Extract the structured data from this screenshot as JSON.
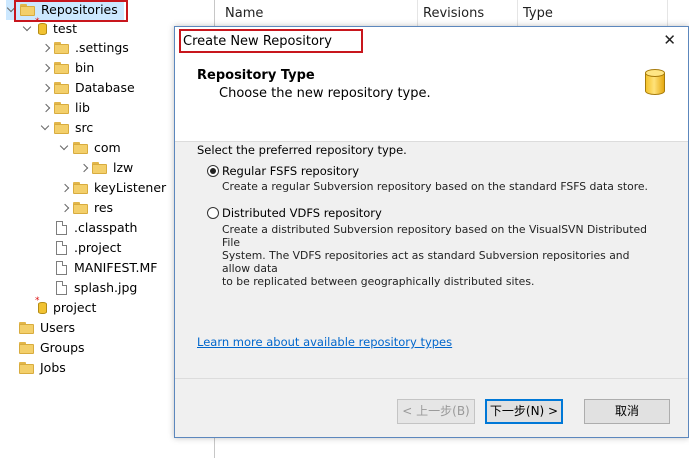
{
  "tree": {
    "root": "Repositories",
    "repo_test": "test",
    "settings": ".settings",
    "bin": "bin",
    "database": "Database",
    "lib": "lib",
    "src": "src",
    "com": "com",
    "lzw": "lzw",
    "keylistener": "keyListener",
    "res": "res",
    "classpath": ".classpath",
    "project_file": ".project",
    "manifest": "MANIFEST.MF",
    "splash": "splash.jpg",
    "repo_project": "project",
    "users": "Users",
    "groups": "Groups",
    "jobs": "Jobs",
    "modified_marker": "*"
  },
  "grid": {
    "columns": [
      "Name",
      "Revisions",
      "Type"
    ]
  },
  "dialog": {
    "title": "Create New Repository",
    "close_glyph": "✕",
    "header_title": "Repository Type",
    "header_subtitle": "Choose the new repository type.",
    "prompt": "Select the preferred repository type.",
    "option_fsfs": {
      "label": "Regular FSFS repository",
      "selected": true,
      "description": "Create a regular Subversion repository based on the standard FSFS data store."
    },
    "option_vdfs": {
      "label": "Distributed VDFS repository",
      "selected": false,
      "description_lines": [
        "Create a distributed Subversion repository based on the VisualSVN Distributed File",
        "System. The VDFS repositories act as standard Subversion repositories and allow data",
        "to be replicated between geographically distributed sites."
      ]
    },
    "learn_more_link": "Learn more about available repository types",
    "buttons": {
      "back": "< 上一步(B)",
      "next": "下一步(N) >",
      "cancel": "取消"
    }
  },
  "colors": {
    "highlight_box": "#c8161d",
    "link": "#0066cc",
    "primary_border": "#0078d7",
    "selection": "#cce8ff"
  }
}
